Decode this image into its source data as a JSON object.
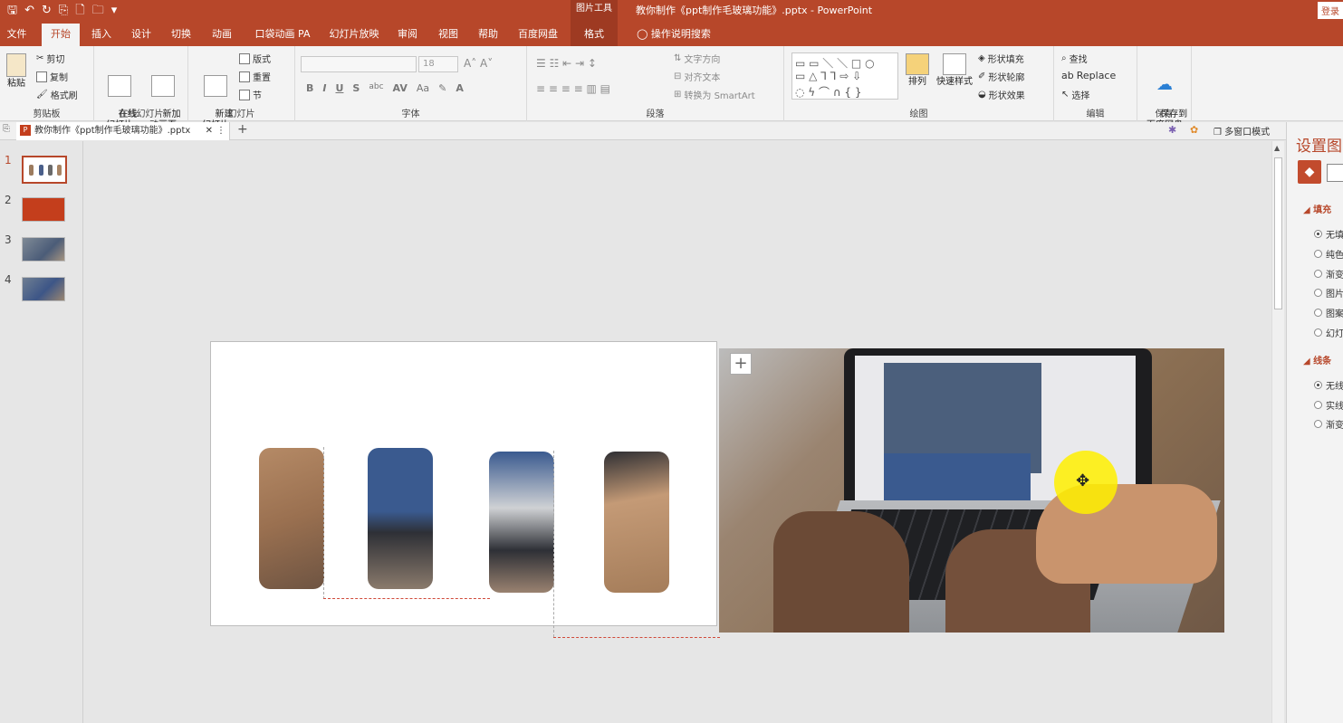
{
  "titlebar": {
    "qat": [
      "🖫",
      "↶",
      "↻",
      "⎘",
      "🗋",
      "🗀",
      "▾"
    ],
    "tools_title": "图片工具",
    "doc_title": "教你制作《ppt制作毛玻璃功能》.pptx  -  PowerPoint",
    "login": "登录"
  },
  "menu": {
    "tabs": [
      "文件",
      "开始",
      "插入",
      "设计",
      "切换",
      "动画",
      "口袋动画 PA",
      "幻灯片放映",
      "审阅",
      "视图",
      "帮助",
      "百度网盘",
      "格式"
    ],
    "search": "操作说明搜索"
  },
  "ribbon": {
    "clipboard": {
      "paste": "粘贴",
      "cut": "剪切",
      "copy": "复制",
      "format_painter": "格式刷",
      "label": "剪贴板"
    },
    "online": {
      "online_slides": "在线\n幻灯片",
      "new_anim": "新加\n动画页",
      "label": "在线幻灯片"
    },
    "slides": {
      "new_slide": "新建\n幻灯片",
      "layout": "版式",
      "reset": "重置",
      "section": "节",
      "label": "幻灯片"
    },
    "font": {
      "size": "18",
      "label": "字体",
      "format_buttons": [
        "B",
        "I",
        "U",
        "S",
        "abc",
        "AV",
        "Aa",
        "A"
      ]
    },
    "paragraph": {
      "text_direction": "文字方向",
      "align_text": "对齐文本",
      "smartart": "转换为 SmartArt",
      "label": "段落"
    },
    "drawing": {
      "arrange": "排列",
      "quick_styles": "快速样式",
      "shape_fill": "形状填充",
      "shape_outline": "形状轮廓",
      "shape_effects": "形状效果",
      "label": "绘图"
    },
    "editing": {
      "find": "查找",
      "replace": "Replace",
      "select": "选择",
      "label": "编辑"
    },
    "save": {
      "save_baidu": "保存到\n百度网盘",
      "label": "保存"
    }
  },
  "docstrip": {
    "tab_title": "教你制作《ppt制作毛玻璃功能》.pptx",
    "multi_window": "多窗口模式"
  },
  "thumbnails": [
    {
      "num": "1",
      "selected": true
    },
    {
      "num": "2",
      "selected": false
    },
    {
      "num": "3",
      "selected": false
    },
    {
      "num": "4",
      "selected": false
    }
  ],
  "format_pane": {
    "title": "设置图",
    "fill_section": "填充",
    "fill_options": [
      "无填",
      "纯色",
      "渐变",
      "图片",
      "图案",
      "幻灯"
    ],
    "line_section": "线条",
    "line_options": [
      "无线",
      "实线",
      "渐变"
    ]
  },
  "colors": {
    "accent": "#b7472a",
    "screen_blue": "#3a5a8f",
    "wood": "#8a6e52"
  }
}
